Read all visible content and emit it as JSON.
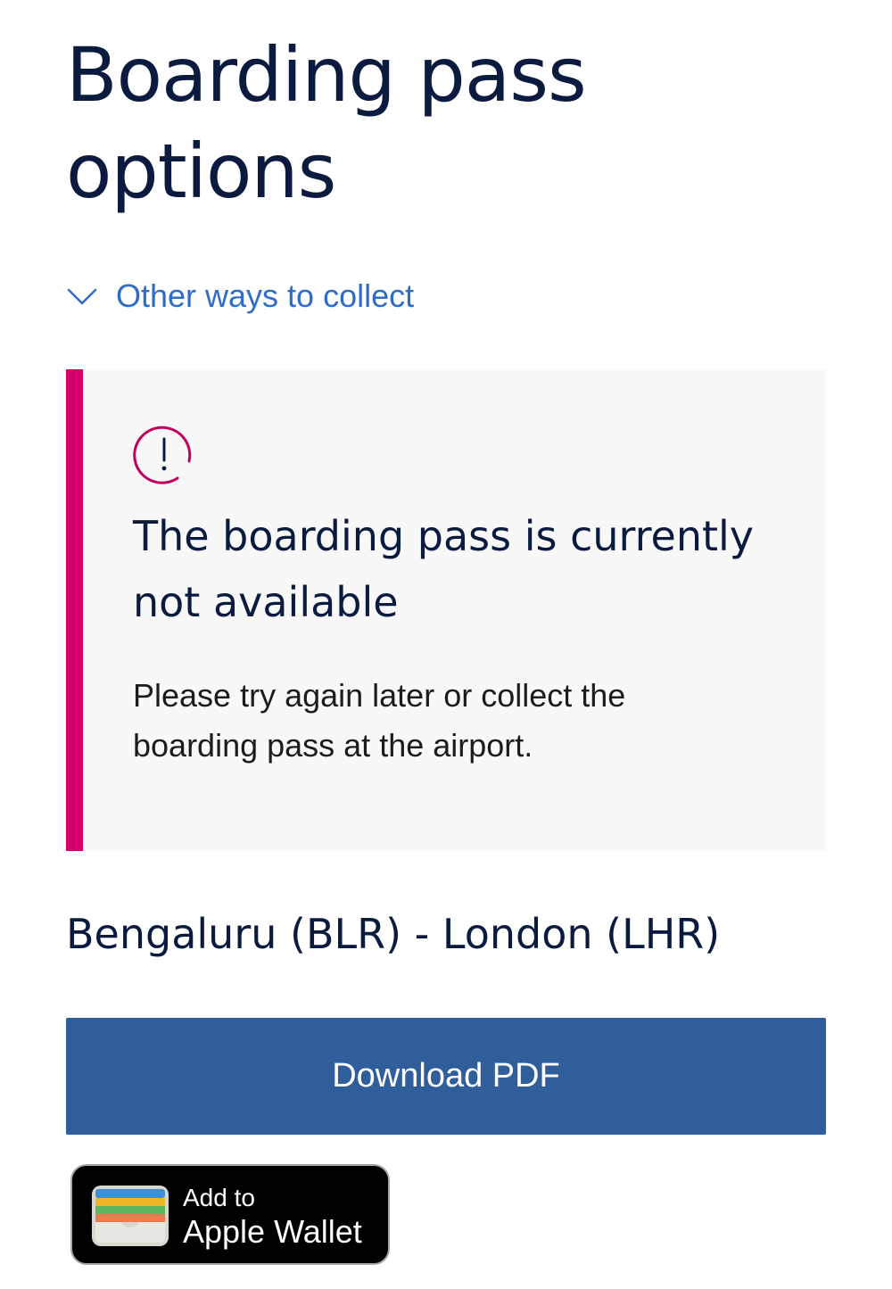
{
  "page": {
    "title": "Boarding pass options"
  },
  "expander": {
    "label": "Other ways to collect",
    "icon": "chevron-down-icon",
    "color": "#2f6cc8"
  },
  "alert": {
    "icon": "exclamation-circle-icon",
    "heading": "The boarding pass is currently not available",
    "body": "Please try again later or collect the boarding pass at the airport.",
    "accent_color": "#d4006a"
  },
  "route": {
    "text": "Bengaluru (BLR) - London (LHR)"
  },
  "actions": {
    "download_label": "Download PDF",
    "download_color": "#2f5e9b",
    "wallet_line1": "Add to",
    "wallet_line2": "Apple Wallet",
    "wallet_icon": "apple-wallet-icon"
  }
}
